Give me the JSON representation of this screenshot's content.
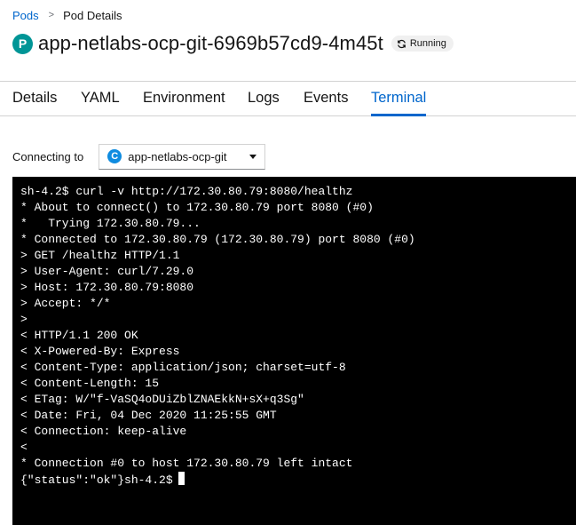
{
  "breadcrumb": {
    "parent": "Pods",
    "separator": ">",
    "current": "Pod Details"
  },
  "header": {
    "resource_badge": "P",
    "title": "app-netlabs-ocp-git-6969b57cd9-4m45t",
    "status": "Running",
    "status_icon": "sync-icon"
  },
  "tabs": [
    {
      "label": "Details",
      "active": false
    },
    {
      "label": "YAML",
      "active": false
    },
    {
      "label": "Environment",
      "active": false
    },
    {
      "label": "Logs",
      "active": false
    },
    {
      "label": "Events",
      "active": false
    },
    {
      "label": "Terminal",
      "active": true
    }
  ],
  "terminal_controls": {
    "connect_label": "Connecting to",
    "container_badge": "C",
    "container_name": "app-netlabs-ocp-git"
  },
  "terminal": {
    "lines": [
      "sh-4.2$ curl -v http://172.30.80.79:8080/healthz",
      "* About to connect() to 172.30.80.79 port 8080 (#0)",
      "*   Trying 172.30.80.79...",
      "* Connected to 172.30.80.79 (172.30.80.79) port 8080 (#0)",
      "> GET /healthz HTTP/1.1",
      "> User-Agent: curl/7.29.0",
      "> Host: 172.30.80.79:8080",
      "> Accept: */*",
      ">",
      "< HTTP/1.1 200 OK",
      "< X-Powered-By: Express",
      "< Content-Type: application/json; charset=utf-8",
      "< Content-Length: 15",
      "< ETag: W/\"f-VaSQ4oDUiZblZNAEkkN+sX+q3Sg\"",
      "< Date: Fri, 04 Dec 2020 11:25:55 GMT",
      "< Connection: keep-alive",
      "<",
      "* Connection #0 to host 172.30.80.79 left intact",
      "{\"status\":\"ok\"}sh-4.2$"
    ]
  },
  "colors": {
    "link": "#0066cc",
    "pod_badge": "#009596",
    "container_badge": "#0f8ce0",
    "terminal_bg": "#000000",
    "terminal_fg": "#ffffff"
  }
}
